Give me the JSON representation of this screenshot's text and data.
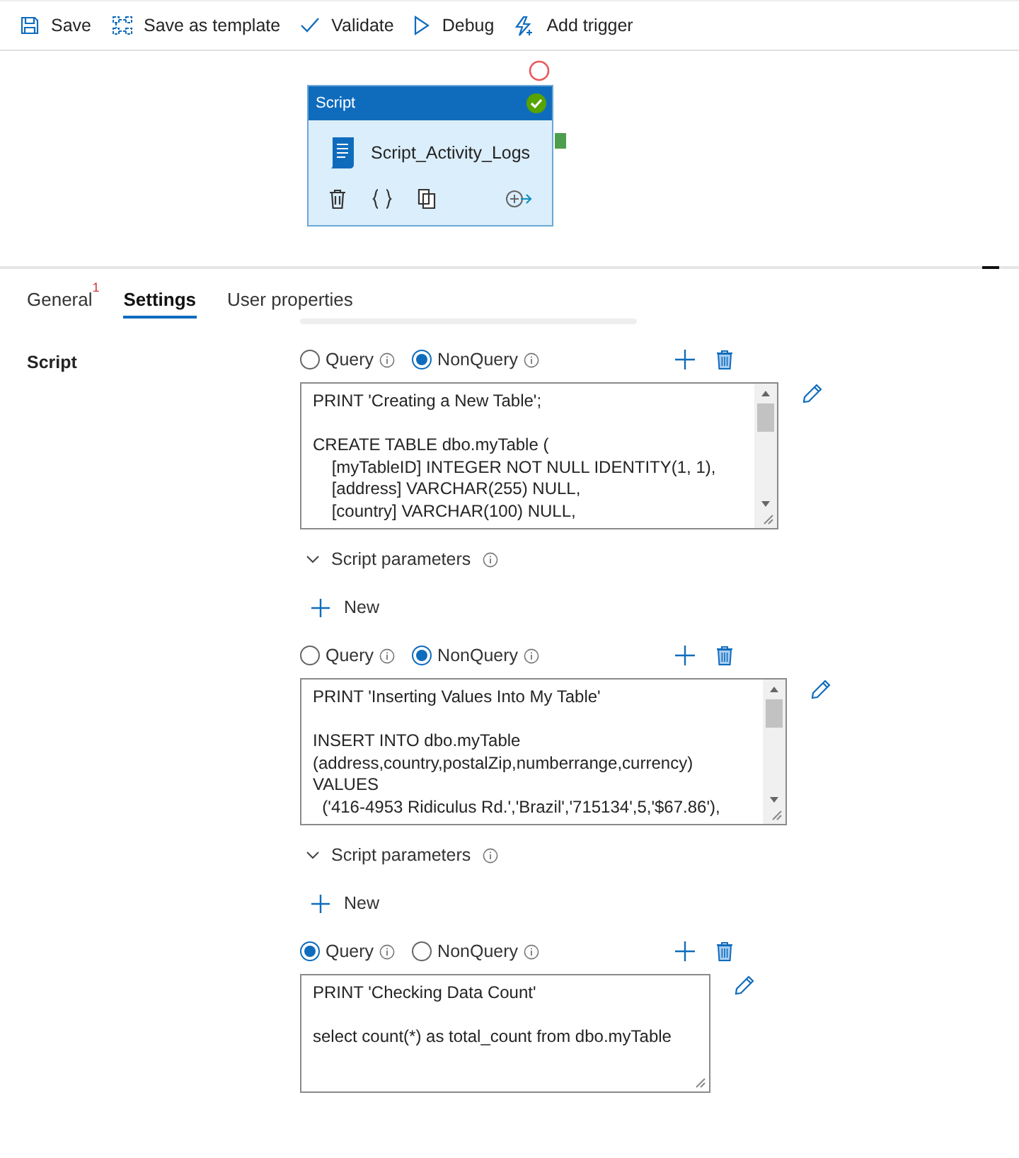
{
  "toolbar": [
    {
      "label": "Save"
    },
    {
      "label": "Save as template"
    },
    {
      "label": "Validate"
    },
    {
      "label": "Debug"
    },
    {
      "label": "Add trigger"
    }
  ],
  "activity": {
    "type_label": "Script",
    "name": "Script_Activity_Logs",
    "valid": true
  },
  "tabs": [
    {
      "label": "General",
      "badge": "1",
      "selected": false
    },
    {
      "label": "Settings",
      "selected": true
    },
    {
      "label": "User properties",
      "selected": false
    }
  ],
  "settings": {
    "label": "Script",
    "scripts": [
      {
        "options": [
          {
            "label": "Query",
            "selected": false
          },
          {
            "label": "NonQuery",
            "selected": true
          }
        ],
        "code": "PRINT 'Creating a New Table';\n\nCREATE TABLE dbo.myTable (\n    [myTableID] INTEGER NOT NULL IDENTITY(1, 1),\n    [address] VARCHAR(255) NULL,\n    [country] VARCHAR(100) NULL,",
        "parameters_label": "Script parameters",
        "new_label": "New"
      },
      {
        "options": [
          {
            "label": "Query",
            "selected": false
          },
          {
            "label": "NonQuery",
            "selected": true
          }
        ],
        "code": "PRINT 'Inserting Values Into My Table'\n\nINSERT INTO dbo.myTable\n(address,country,postalZip,numberrange,currency)\nVALUES\n  ('416-4953 Ridiculus Rd.','Brazil','715134',5,'$67.86'),",
        "parameters_label": "Script parameters",
        "new_label": "New"
      },
      {
        "options": [
          {
            "label": "Query",
            "selected": true
          },
          {
            "label": "NonQuery",
            "selected": false
          }
        ],
        "code": "PRINT 'Checking Data Count'\n\nselect count(*) as total_count from dbo.myTable"
      }
    ]
  }
}
